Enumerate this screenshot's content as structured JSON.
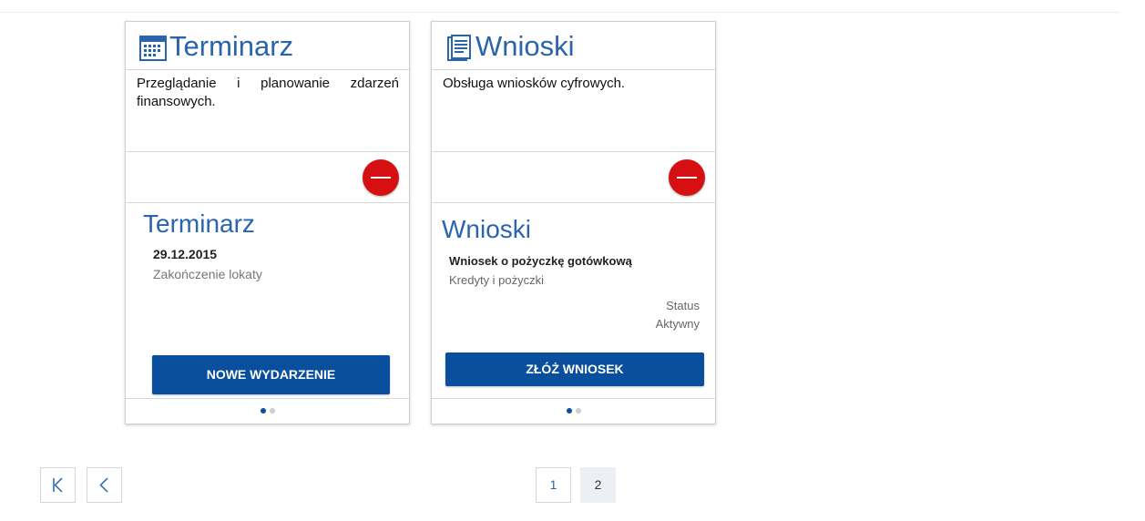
{
  "cards": [
    {
      "header": {
        "title": "Terminarz",
        "icon": "calendar-icon"
      },
      "description": "Przeglądanie i planowanie zdarzeń finansowych.",
      "widget": {
        "title": "Terminarz",
        "event": {
          "date": "29.12.2015",
          "description": "Zakończenie lokaty"
        },
        "button_label": "NOWE WYDARZENIE"
      },
      "pager_dots": {
        "count": 2,
        "active": 1
      }
    },
    {
      "header": {
        "title": "Wnioski",
        "icon": "document-form-icon"
      },
      "description": "Obsługa wniosków cyfrowych.",
      "widget": {
        "title": "Wnioski",
        "request": {
          "name": "Wniosek o pożyczkę gotówkową",
          "category": "Kredyty i pożyczki",
          "status_label": "Status",
          "status_value": "Aktywny"
        },
        "button_label": "ZŁÓŻ WNIOSEK"
      },
      "pager_dots": {
        "count": 2,
        "active": 1
      }
    }
  ],
  "pagination": {
    "first_label": "K",
    "prev_label": "<",
    "pages": [
      "1",
      "2"
    ],
    "current_page": "2"
  },
  "colors": {
    "accent": "#2a64ad",
    "button": "#0a4f9e",
    "remove": "#d50f12"
  }
}
